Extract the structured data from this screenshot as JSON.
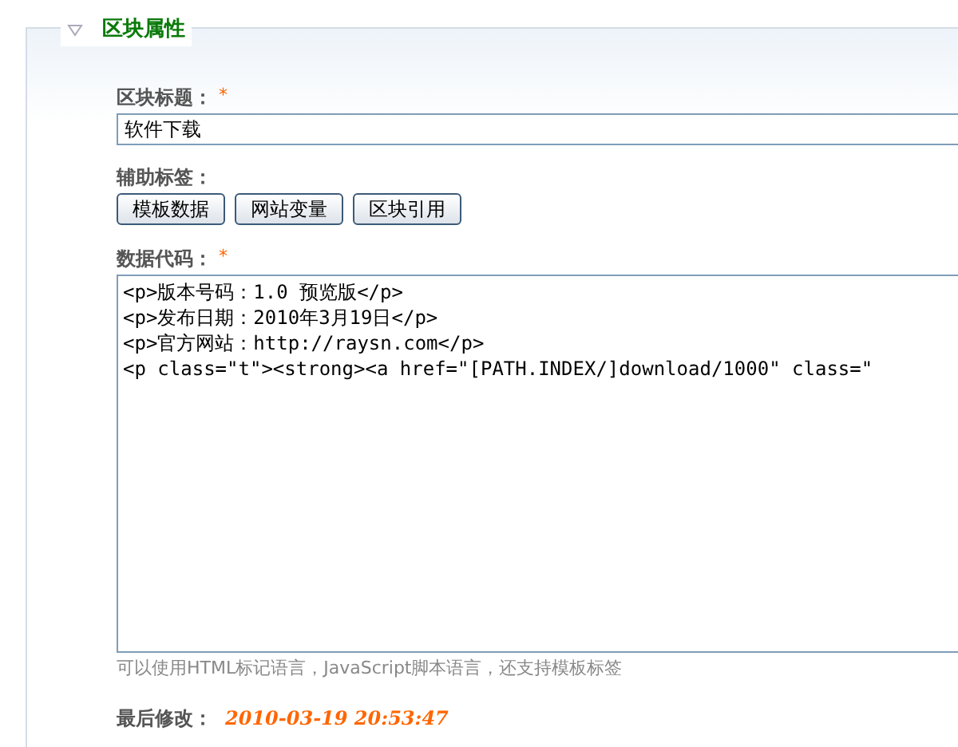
{
  "section": {
    "title": "区块属性",
    "expanded": true
  },
  "title_field": {
    "label": "区块标题：",
    "required_mark": "*",
    "value": "软件下载"
  },
  "tags": {
    "label": "辅助标签：",
    "buttons": [
      "模板数据",
      "网站变量",
      "区块引用"
    ]
  },
  "code_field": {
    "label": "数据代码：",
    "required_mark": "*",
    "lines": [
      "<p>版本号码：1.0 预览版</p>",
      "<p>发布日期：2010年3月19日</p>",
      "<p>官方网站：http://raysn.com</p>",
      "<p class=\"t\"><strong><a href=\"[PATH.INDEX/]download/1000\" class=\""
    ],
    "hint": "可以使用HTML标记语言，JavaScript脚本语言，还支持模板标签"
  },
  "last_modified": {
    "label": "最后修改：",
    "value": "2010-03-19 20:53:47"
  }
}
